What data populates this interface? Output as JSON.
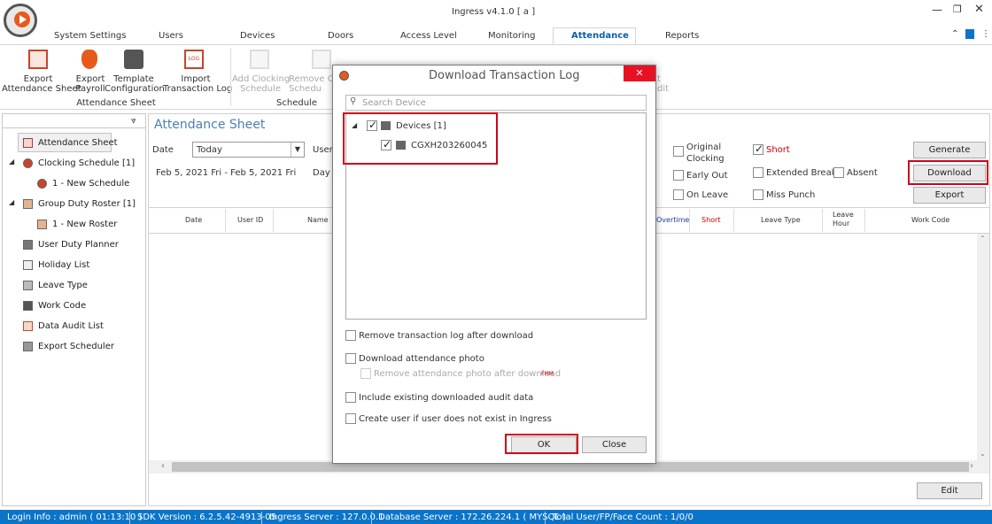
{
  "window": {
    "title": "Ingress v4.1.0 [ a ]"
  },
  "tabs": [
    "System Settings",
    "Users",
    "Devices",
    "Doors",
    "Access Level",
    "Monitoring",
    "Attendance",
    "Reports"
  ],
  "ribbon": {
    "export_attendance": "Export\nAttendance Sheet",
    "export_payroll": "Export\nPayroll",
    "template_config": "Template\nConfiguration",
    "import_log": "Import\nTransaction Log",
    "group1": "Attendance Sheet",
    "add_clocking": "Add Clocking\nSchedule",
    "remove_clocking": "Remove C\nSchedu",
    "group2": "Schedule",
    "edit_partial": "t\ndit"
  },
  "sidebar": {
    "items": [
      "Attendance Sheet",
      "Clocking Schedule [1]",
      "1 - New Schedule",
      "Group Duty Roster [1]",
      "1 - New Roster",
      "User Duty Planner",
      "Holiday List",
      "Leave Type",
      "Work Code",
      "Data Audit List",
      "Export Scheduler"
    ]
  },
  "main": {
    "title": "Attendance Sheet",
    "date_label": "Date",
    "date_value": "Today",
    "user_label": "User",
    "date_range": "Feb 5, 2021 Fri - Feb 5, 2021 Fri",
    "day_label": "Day T",
    "options": {
      "original_clocking": "Original\nClocking",
      "short": "Short",
      "early_out": "Early Out",
      "extended_break": "Extended Break",
      "absent": "Absent",
      "on_leave": "On Leave",
      "miss_punch": "Miss Punch"
    },
    "buttons": {
      "generate": "Generate",
      "download": "Download",
      "export": "Export",
      "edit": "Edit"
    },
    "columns": [
      "Date",
      "User ID",
      "Name",
      "Overtime",
      "Short",
      "Leave Type",
      "Leave\nHour",
      "Work Code"
    ]
  },
  "dialog": {
    "title": "Download Transaction Log",
    "search_placeholder": "Search Device",
    "tree_root": "Devices [1]",
    "tree_child": "CGXH203260045",
    "opt_remove_log": "Remove transaction log after download",
    "opt_download_photo": "Download attendance photo",
    "opt_remove_photo": "Remove attendance photo after download",
    "opt_remove_photo_tag": "FMM",
    "opt_include_audit": "Include existing downloaded audit data",
    "opt_create_user": "Create user if user does not exist in Ingress",
    "ok": "OK",
    "close": "Close"
  },
  "status": {
    "login": "Login Info : admin ( 01:13:10 )",
    "sdk": "SDK Version : 6.2.5.42-4913-05",
    "ingress_server": "Ingress Server : 127.0.0.1",
    "db_server": "Database Server : 172.26.224.1 ( MYSQL )",
    "user_count": "Total User/FP/Face Count : 1/0/0"
  },
  "colors": {
    "accent": "#0078d7",
    "highlight": "#d0021b",
    "status_bar": "#0a74c9"
  }
}
